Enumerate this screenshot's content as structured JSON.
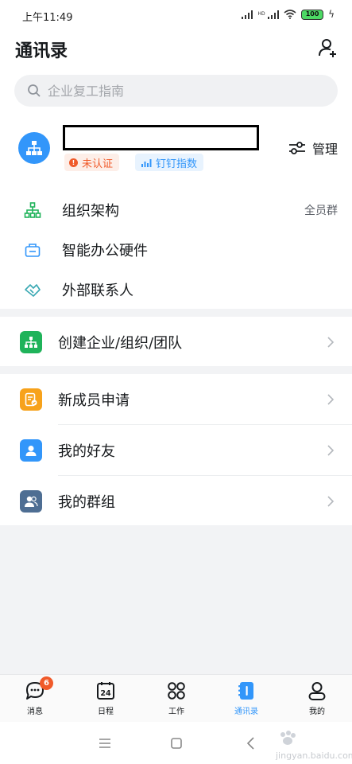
{
  "status_bar": {
    "time": "上午11:49",
    "battery": "100"
  },
  "header": {
    "title": "通讯录"
  },
  "search": {
    "placeholder": "企业复工指南"
  },
  "org": {
    "badges": {
      "unverified": "未认证",
      "dingtalk_index": "钉钉指数"
    },
    "manage_label": "管理"
  },
  "org_links": [
    {
      "label": "组织架构",
      "extra": "全员群",
      "icon": "org-chart-icon"
    },
    {
      "label": "智能办公硬件",
      "icon": "device-icon"
    },
    {
      "label": "外部联系人",
      "icon": "handshake-icon"
    }
  ],
  "create": {
    "label": "创建企业/组织/团队",
    "icon": "org-create-icon",
    "color": "#1fb35a"
  },
  "lists": [
    {
      "label": "新成员申请",
      "icon": "new-member-icon",
      "color": "#f7a21b"
    },
    {
      "label": "我的好友",
      "icon": "friend-icon",
      "color": "#3296fa"
    },
    {
      "label": "我的群组",
      "icon": "group-icon",
      "color": "#4e6e93"
    }
  ],
  "tabs": [
    {
      "label": "消息",
      "badge": "6",
      "icon": "message-icon"
    },
    {
      "label": "日程",
      "icon": "calendar-icon",
      "date": "24"
    },
    {
      "label": "工作",
      "icon": "work-grid-icon"
    },
    {
      "label": "通讯录",
      "icon": "contacts-icon",
      "active": true
    },
    {
      "label": "我的",
      "icon": "profile-icon"
    }
  ],
  "watermark": {
    "text": "jingyan.baidu.com"
  },
  "colors": {
    "accent": "#3296fa",
    "warning": "#f05a2a",
    "bg": "#f2f3f5"
  }
}
